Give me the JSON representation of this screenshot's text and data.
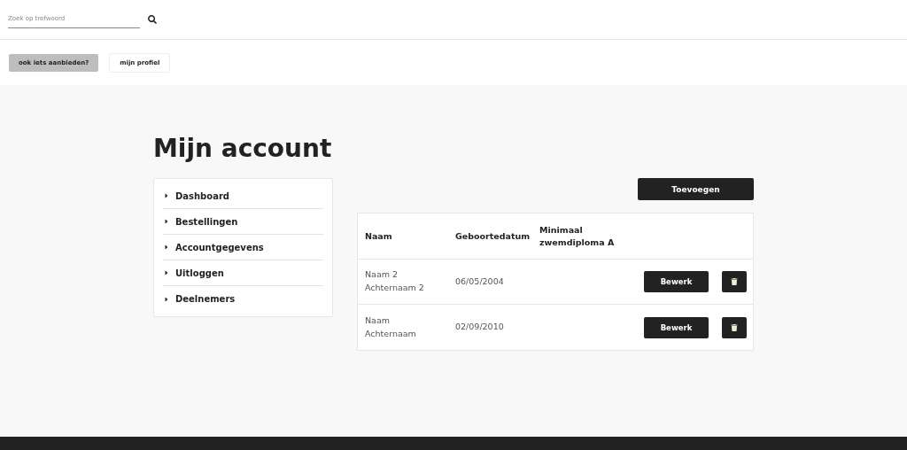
{
  "search": {
    "placeholder": "Zoek op trefwoord"
  },
  "top_buttons": [
    {
      "label": "ook iets aanbieden?",
      "kind": "primary"
    },
    {
      "label": "mijn profiel",
      "kind": "outline"
    }
  ],
  "title": "Mijn account",
  "sidebar": {
    "items": [
      "Dashboard",
      "Bestellingen",
      "Accountgegevens",
      "Uitloggen",
      "Deelnemers"
    ]
  },
  "add_button": "Toevoegen",
  "table": {
    "columns": [
      "Naam",
      "Geboortedatum",
      "Minimaal zwemdiploma A"
    ],
    "rows": [
      {
        "name": "Naam 2 Achternaam 2",
        "birthdate": "06/05/2004",
        "edit": "Bewerk"
      },
      {
        "name": "Naam Achternaam",
        "birthdate": "02/09/2010",
        "edit": "Bewerk"
      }
    ]
  }
}
